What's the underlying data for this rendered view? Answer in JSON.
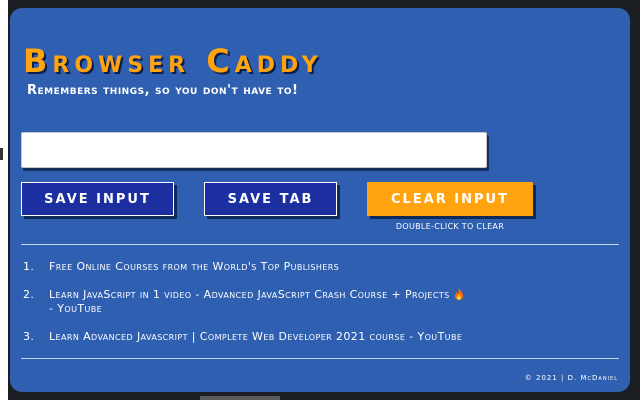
{
  "app": {
    "title": "Browser Caddy",
    "tagline": "Remembers things, so you don't have to!"
  },
  "input": {
    "value": "",
    "placeholder": ""
  },
  "buttons": {
    "save_input": "SAVE INPUT",
    "save_tab": "SAVE TAB",
    "clear_input": "CLEAR INPUT",
    "clear_hint": "DOUBLE-CLICK TO CLEAR"
  },
  "saved_items": [
    {
      "number": "1.",
      "text": "Free Online Courses from the World's Top Publishers"
    },
    {
      "number": "2.",
      "text": "Learn JavaScript in 1 video - Advanced JavaScript Crash Course + Projects",
      "suffix": "- YouTube",
      "icon": "fire-icon"
    },
    {
      "number": "3.",
      "text": "Learn Advanced Javascript | Complete Web Developer 2021 course - YouTube"
    }
  ],
  "footer": "© 2021 | D. McDaniel",
  "colors": {
    "panel": "#2f5fb0",
    "accent": "#ffa30f",
    "button_blue": "#1b2fa0"
  }
}
